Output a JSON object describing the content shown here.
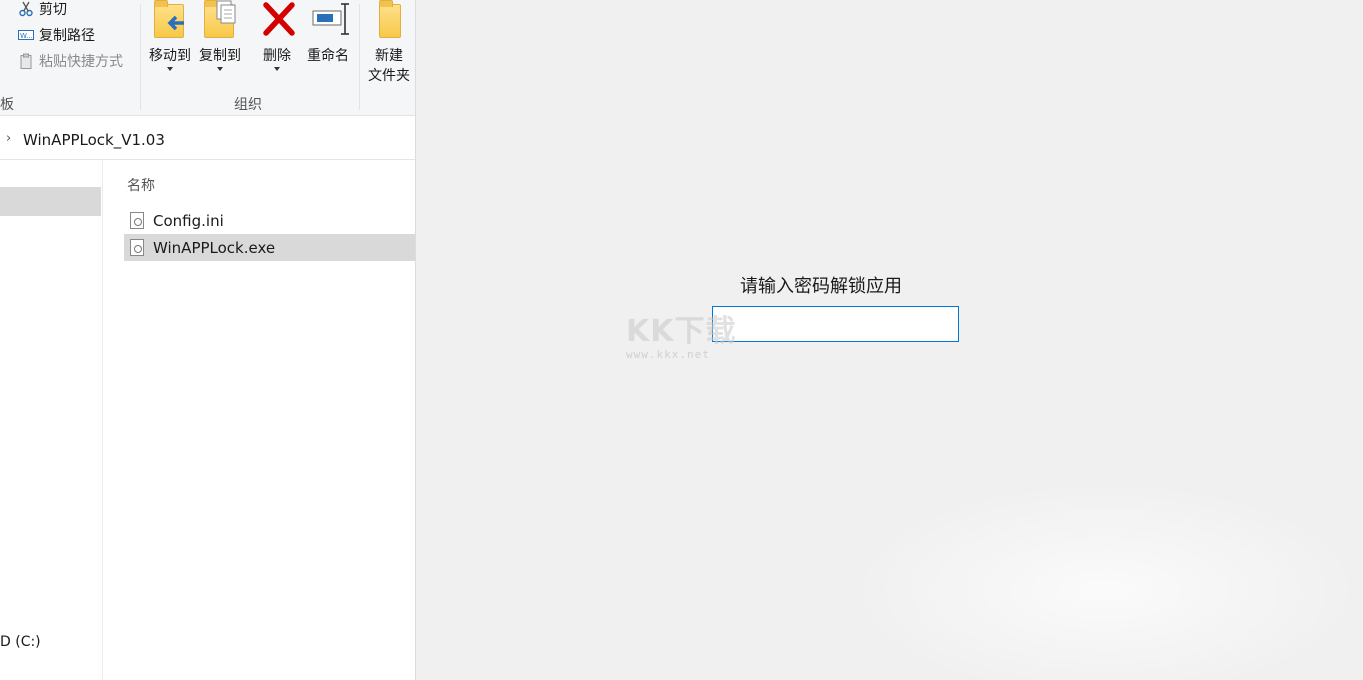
{
  "ribbon": {
    "clipboard": {
      "cut_label": "剪切",
      "copy_path_label": "复制路径",
      "paste_shortcut_label": "粘贴快捷方式",
      "group_label": "板"
    },
    "organize": {
      "move_to_label": "移动到",
      "copy_to_label": "复制到",
      "delete_label": "删除",
      "rename_label": "重命名",
      "group_label": "组织"
    },
    "new": {
      "new_folder_line1": "新建",
      "new_folder_line2": "文件夹"
    }
  },
  "address": {
    "path": "WinAPPLock_V1.03"
  },
  "navpane": {
    "drive_label": "D (C:)"
  },
  "filelist": {
    "column_name": "名称",
    "files": [
      {
        "name": "Config.ini",
        "selected": false
      },
      {
        "name": "WinAPPLock.exe",
        "selected": true
      }
    ]
  },
  "lock": {
    "prompt": "请输入密码解锁应用",
    "password_value": ""
  },
  "watermark": {
    "main": "KK下载",
    "url": "www.kkx.net"
  },
  "colors": {
    "accent_border": "#0078d7",
    "selection": "#d9d9d9",
    "delete_red": "#d40000",
    "folder_yellow": "#f7c948"
  }
}
